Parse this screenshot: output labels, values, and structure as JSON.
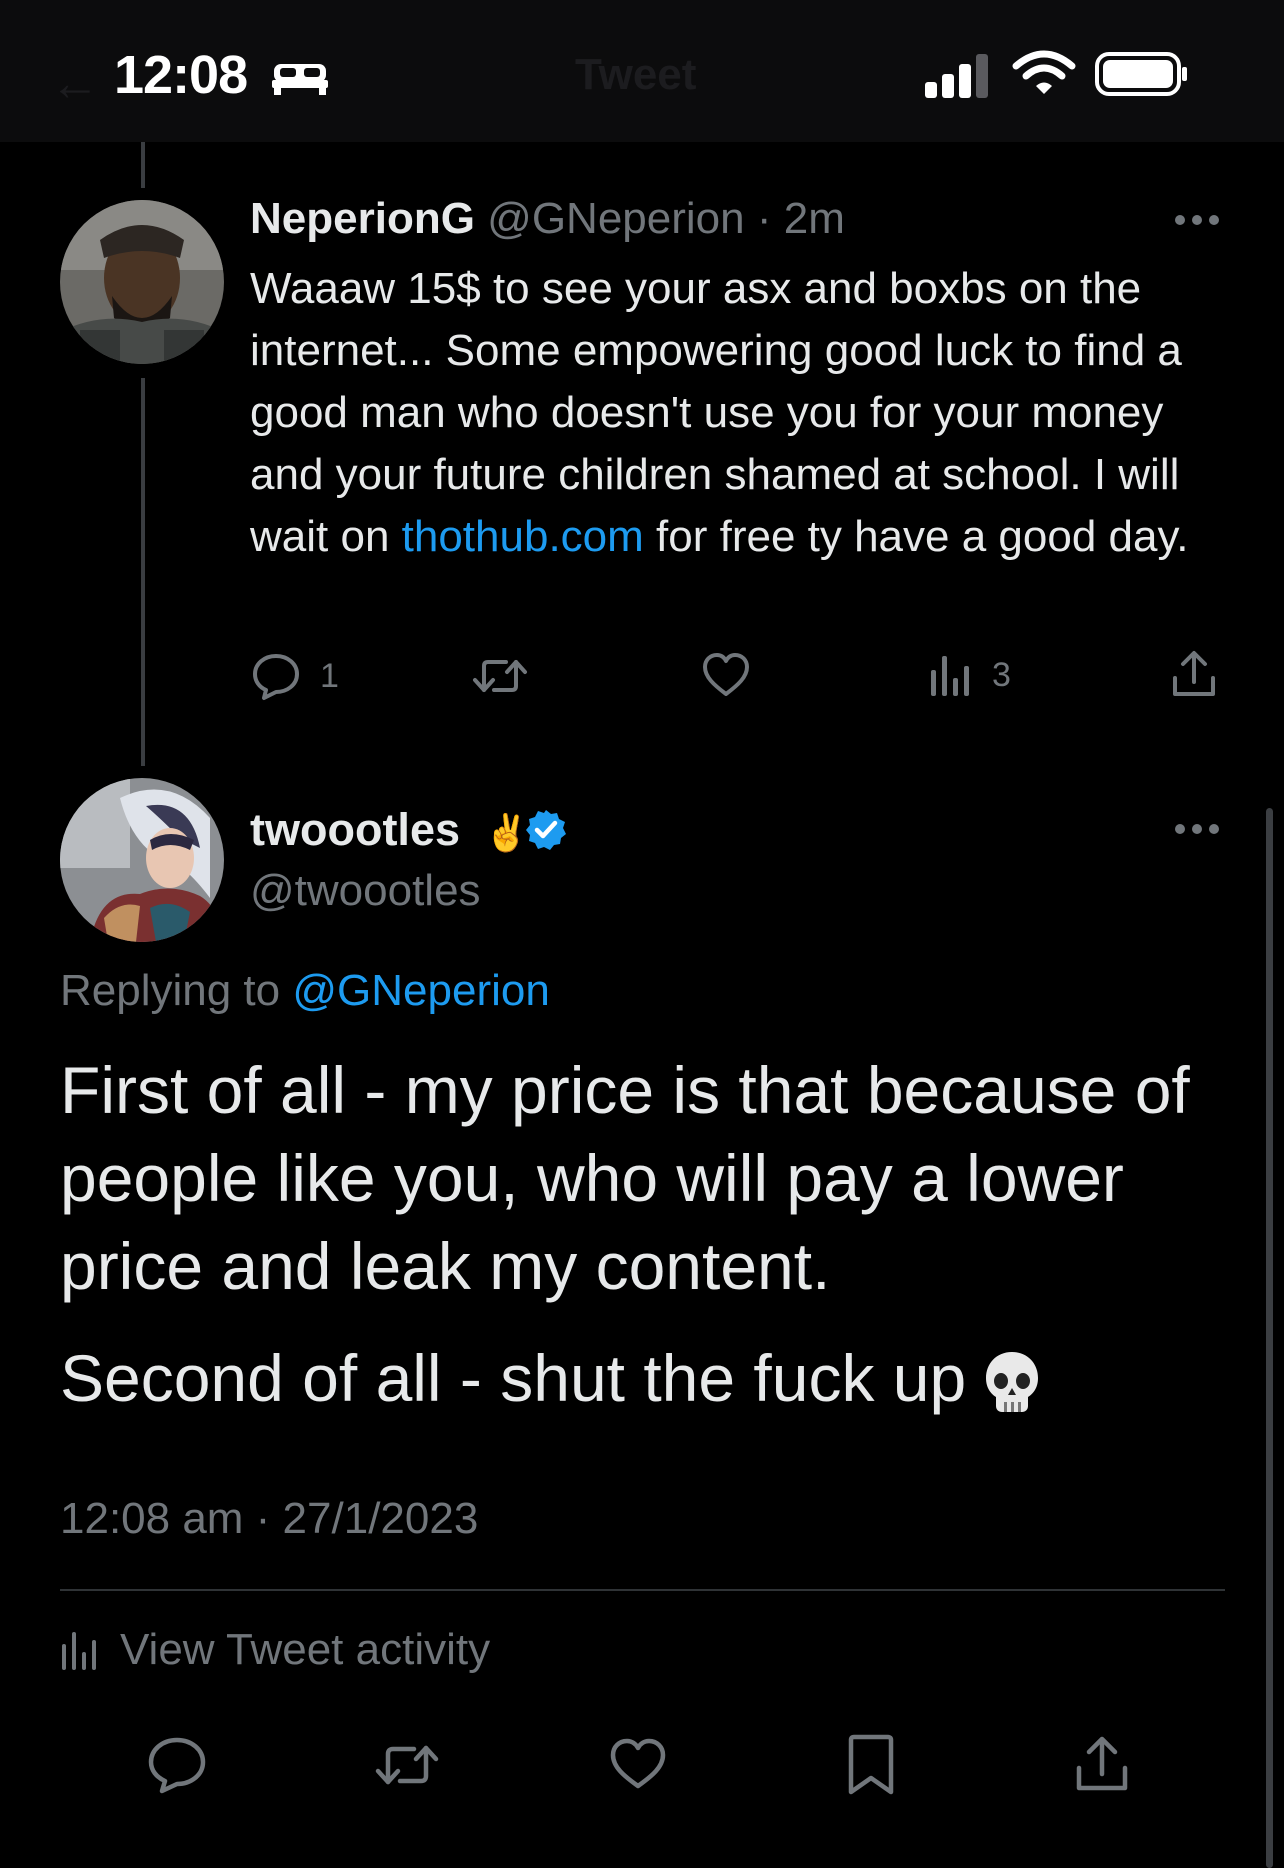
{
  "status_bar": {
    "time": "12:08"
  },
  "nav": {
    "title": "Tweet"
  },
  "parent_tweet": {
    "name": "NeperionG",
    "handle": "@GNeperion",
    "separator": "·",
    "age": "2m",
    "text_before_link": "Waaaw 15$ to see your asx and boxbs on the internet... Some empowering good luck to find a good man who doesn't use you for your money and your future children shamed at school. I will wait on ",
    "link": "thothub.com",
    "text_after_link": " for free ty have a good day.",
    "reply_count": "1",
    "view_count": "3"
  },
  "main_tweet": {
    "name": "twoootles",
    "name_emoji": "✌",
    "handle": "@twoootles",
    "replying_label": "Replying to",
    "replying_to": "@GNeperion",
    "paragraph1": "First of all - my price is that because of people like you, who will pay a lower price and leak my content.",
    "paragraph2": "Second of all - shut the fuck up",
    "timestamp": "12:08 am · 27/1/2023",
    "activity_label": "View Tweet activity"
  },
  "icons": {
    "reply": "reply-icon",
    "retweet": "retweet-icon",
    "like": "heart-icon",
    "views": "views-icon",
    "share": "share-icon",
    "bookmark": "bookmark-icon",
    "skull_emoji": "skull-icon"
  },
  "colors": {
    "background": "#000000",
    "text": "#e7e9ea",
    "muted": "#71767b",
    "link": "#1d9bf0",
    "verified": "#1d9bf0"
  }
}
